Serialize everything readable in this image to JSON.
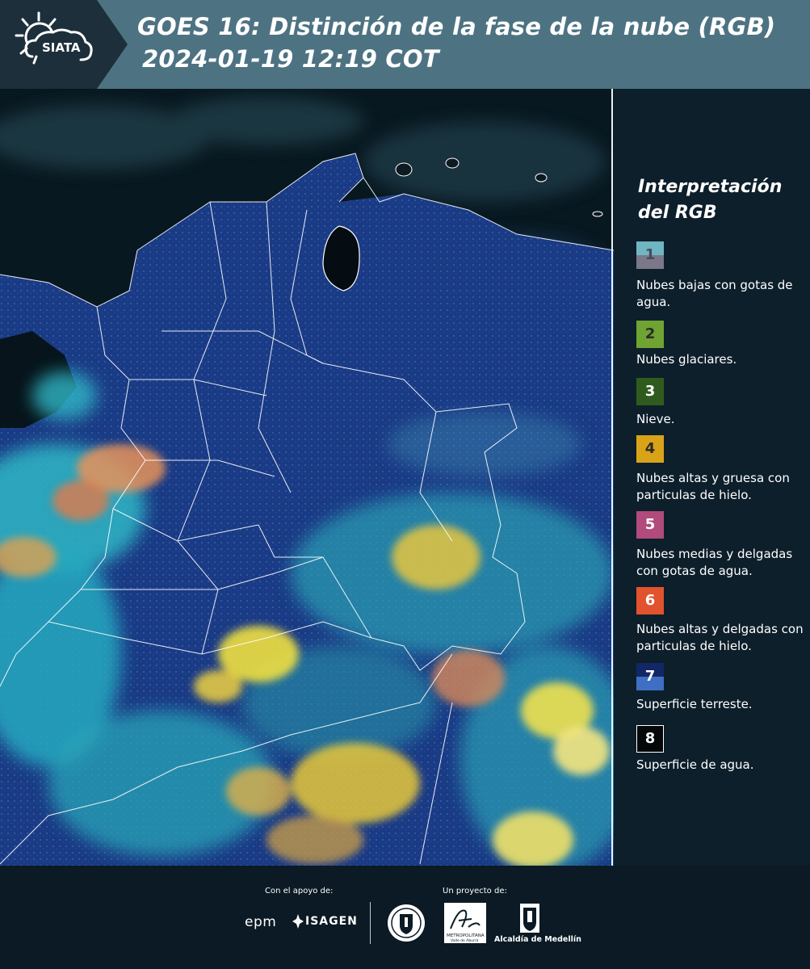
{
  "header": {
    "logo_text": "SIATA",
    "title_line1": "GOES 16: Distinción de la fase de la nube (RGB)",
    "title_line2": "2024-01-19 12:19 COT"
  },
  "legend": {
    "title_line1": "Interpretación",
    "title_line2": "del RGB",
    "items": [
      {
        "num": "1",
        "label": "Nubes bajas con gotas de agua.",
        "color_top": "#6fb6c2",
        "color_bottom": "#7a7889"
      },
      {
        "num": "2",
        "label": "Nubes glaciares.",
        "color": "#6fa332"
      },
      {
        "num": "3",
        "label": "Nieve.",
        "color": "#2f5c1e"
      },
      {
        "num": "4",
        "label": "Nubes altas y gruesa con particulas de hielo.",
        "color": "#d9a318"
      },
      {
        "num": "5",
        "label": "Nubes medias y delgadas con gotas de agua.",
        "color": "#b04b7b"
      },
      {
        "num": "6",
        "label": "Nubes altas y delgadas con particulas de hielo.",
        "color": "#e0532d"
      },
      {
        "num": "7",
        "label": "Superficie terreste.",
        "color_top": "#122766",
        "color_bottom": "#3e6fc4"
      },
      {
        "num": "8",
        "label": "Superficie de agua.",
        "color": "#050808"
      }
    ]
  },
  "footer": {
    "support_label": "Con el apoyo de:",
    "project_label": "Un proyecto de:",
    "epm_logo": "epm",
    "isagen_logo": "ISAGEN",
    "area_logo_line1": "METROPOLITANA",
    "area_logo_line2": "Valle de Aburrá",
    "alcaldia_label": "Alcaldía de Medellín"
  },
  "map": {
    "image": "satellite-rgb-cloud-phase-colombia",
    "border_color": "#ffffff"
  }
}
